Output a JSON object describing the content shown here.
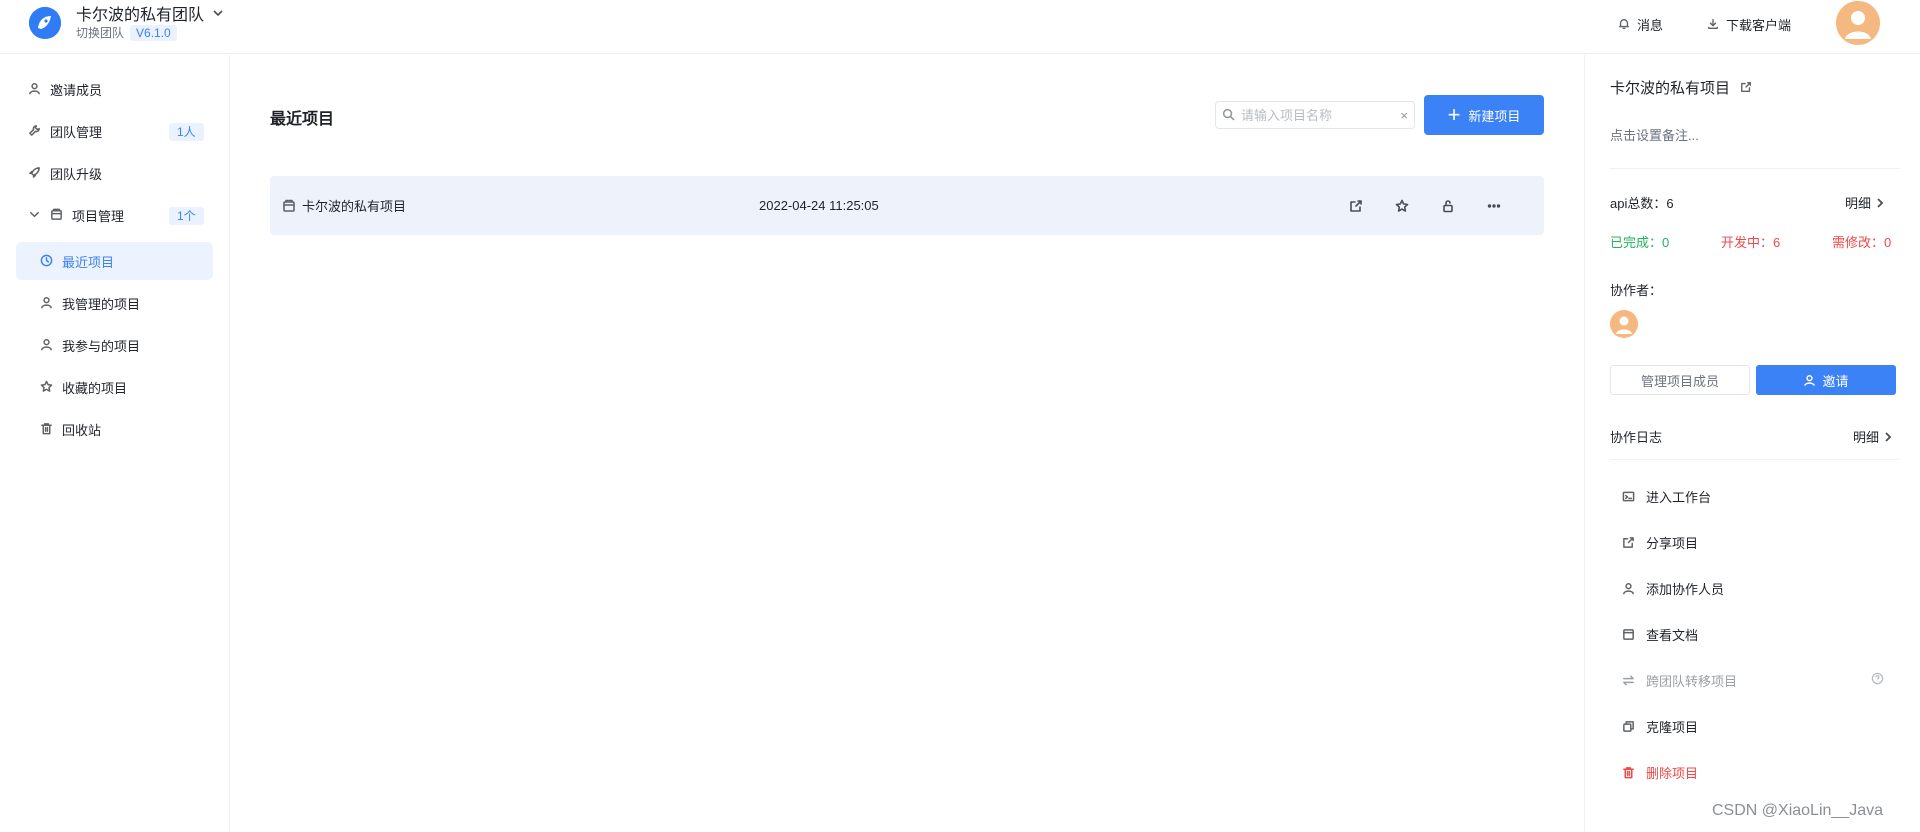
{
  "header": {
    "team_name": "卡尔波的私有团队",
    "switch_team": "切换团队",
    "version": "V6.1.0",
    "messages_label": "消息",
    "download_client_label": "下载客户端"
  },
  "sidebar": {
    "items": [
      {
        "label": "邀请成员"
      },
      {
        "label": "团队管理",
        "badge": "1人"
      },
      {
        "label": "团队升级"
      },
      {
        "label": "项目管理",
        "badge": "1个"
      },
      {
        "label": "最近项目"
      },
      {
        "label": "我管理的项目"
      },
      {
        "label": "我参与的项目"
      },
      {
        "label": "收藏的项目"
      },
      {
        "label": "回收站"
      }
    ]
  },
  "main": {
    "title": "最近项目",
    "search_placeholder": "请输入项目名称",
    "search_clear": "×",
    "new_project_label": "新建项目",
    "projects": [
      {
        "name": "卡尔波的私有项目",
        "date": "2022-04-24 11:25:05"
      }
    ]
  },
  "panel": {
    "project_name": "卡尔波的私有项目",
    "note_placeholder": "点击设置备注...",
    "api_total_label": "api总数：6",
    "details_label": "明细",
    "done_label": "已完成：0",
    "developing_label": "开发中：6",
    "needs_fix_label": "需修改：0",
    "collaborators_label": "协作者：",
    "manage_members_label": "管理项目成员",
    "invite_label": "邀请",
    "log_label": "协作日志",
    "log_details_label": "明细",
    "actions": [
      {
        "label": "进入工作台"
      },
      {
        "label": "分享项目"
      },
      {
        "label": "添加协作人员"
      },
      {
        "label": "查看文档"
      },
      {
        "label": "跨团队转移项目"
      },
      {
        "label": "克隆项目"
      },
      {
        "label": "删除项目"
      }
    ]
  },
  "watermark": "CSDN @XiaoLin__Java",
  "colors": {
    "accent": "#3b82f6",
    "done": "#22b35e",
    "developing": "#f04848",
    "needs_fix": "#f04848",
    "danger": "#f04848"
  }
}
